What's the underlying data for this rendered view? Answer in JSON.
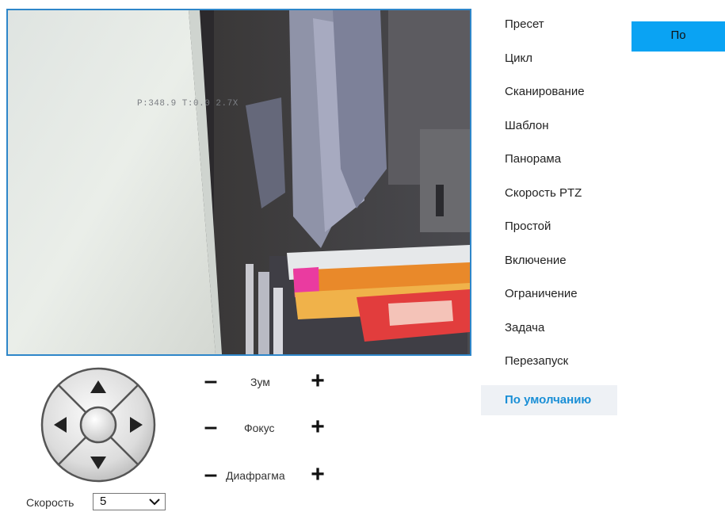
{
  "video": {
    "osd_text": "P:348.9 T:0.0 2.7X"
  },
  "ptz": {
    "speed_label": "Скорость",
    "speed_value": "5",
    "lens": [
      {
        "key": "zoom",
        "label": "Зум",
        "minus": "–",
        "plus": "+"
      },
      {
        "key": "focus",
        "label": "Фокус",
        "minus": "–",
        "plus": "+"
      },
      {
        "key": "iris",
        "label": "Диафрагма",
        "minus": "–",
        "plus": "+"
      }
    ]
  },
  "menu": {
    "items": [
      {
        "label": "Пресет"
      },
      {
        "label": "Цикл"
      },
      {
        "label": "Сканирование"
      },
      {
        "label": "Шаблон"
      },
      {
        "label": "Панорама"
      },
      {
        "label": "Скорость PTZ"
      },
      {
        "label": "Простой"
      },
      {
        "label": "Включение"
      },
      {
        "label": "Ограничение"
      },
      {
        "label": "Задача"
      },
      {
        "label": "Перезапуск"
      },
      {
        "label": "По умолчанию",
        "active": true
      }
    ]
  },
  "action_button": {
    "label": "По"
  },
  "colors": {
    "accent": "#0aa3f3",
    "active_text": "#1a8fd6",
    "video_border": "#2e86c9"
  }
}
